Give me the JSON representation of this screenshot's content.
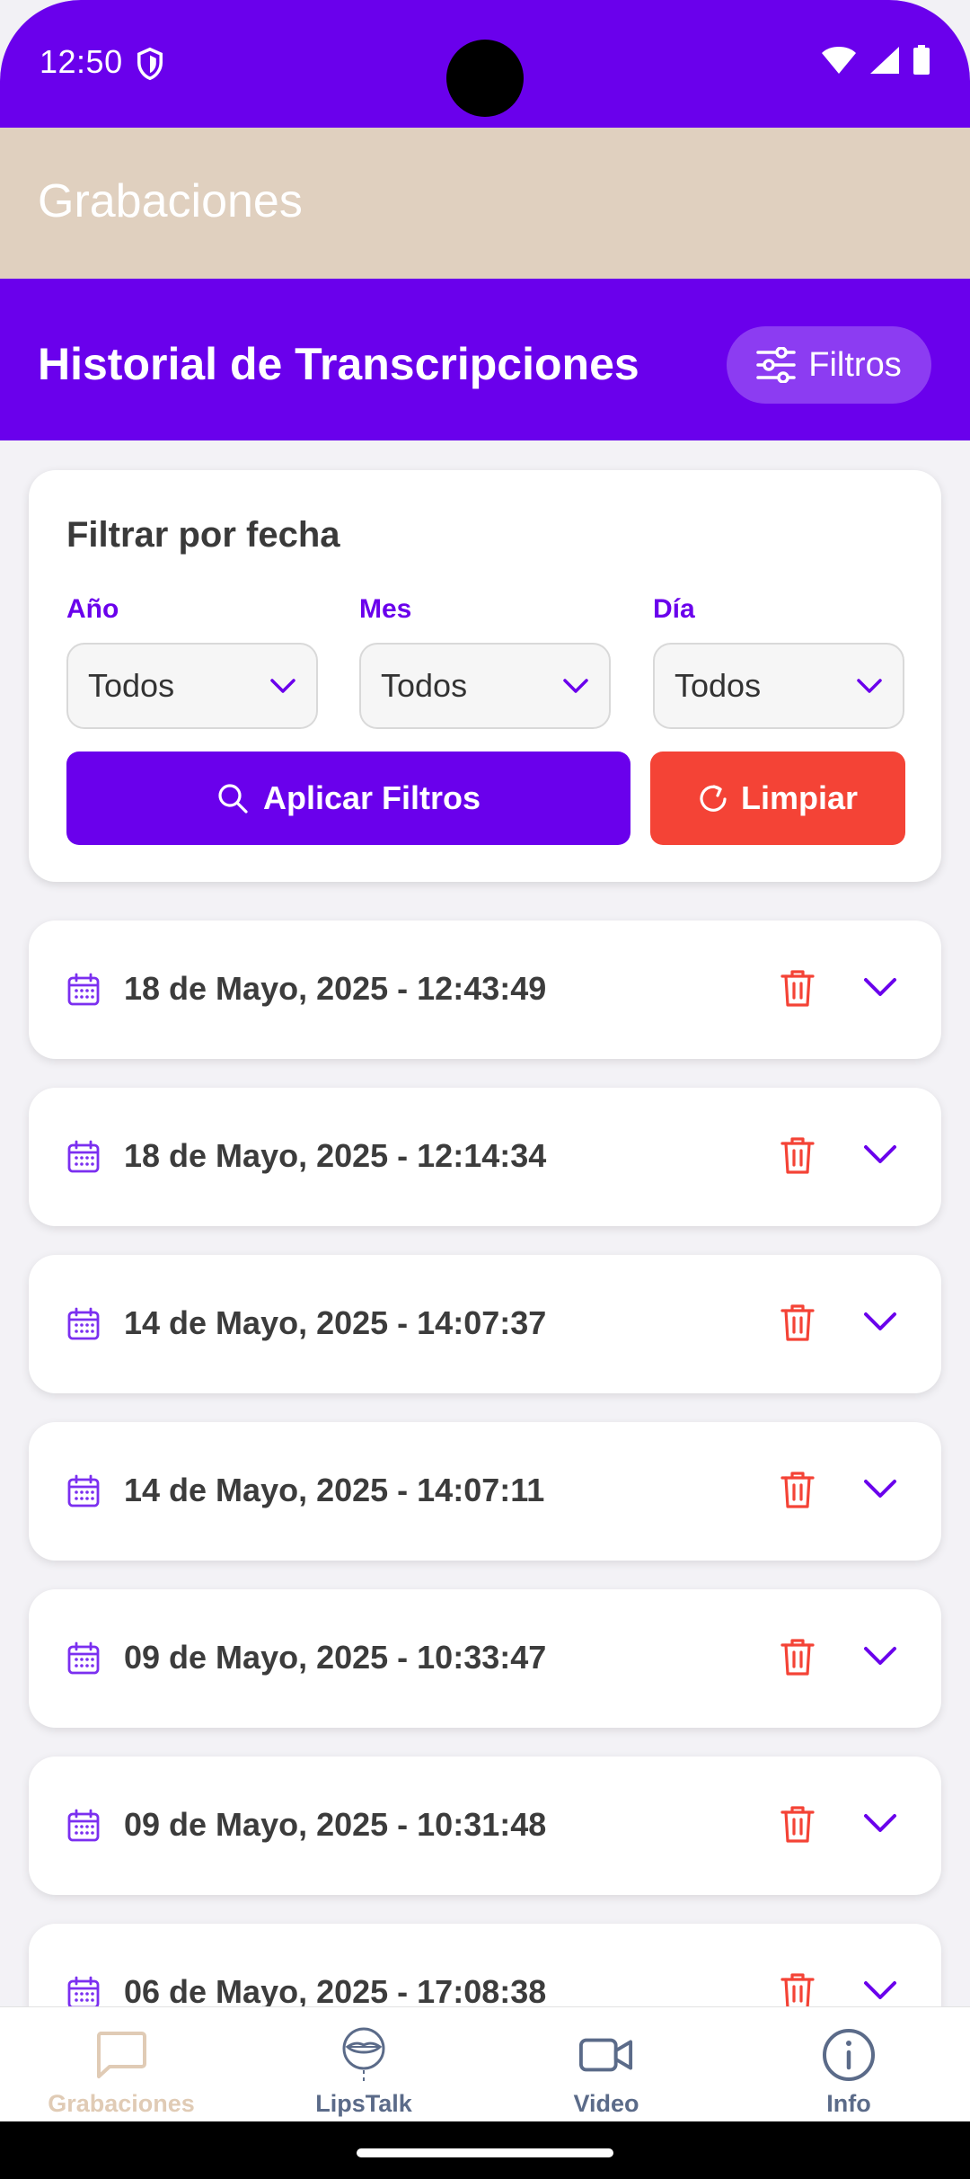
{
  "status_bar": {
    "time": "12:50"
  },
  "app_bar": {
    "title": "Grabaciones"
  },
  "header": {
    "title": "Historial de Transcripciones",
    "filters_button": "Filtros"
  },
  "filter_card": {
    "title": "Filtrar por fecha",
    "fields": [
      {
        "label": "Año",
        "value": "Todos"
      },
      {
        "label": "Mes",
        "value": "Todos"
      },
      {
        "label": "Día",
        "value": "Todos"
      }
    ],
    "apply_label": "Aplicar Filtros",
    "clear_label": "Limpiar"
  },
  "recordings": [
    {
      "date": "18 de Mayo, 2025 - 12:43:49"
    },
    {
      "date": "18 de Mayo, 2025 - 12:14:34"
    },
    {
      "date": "14 de Mayo, 2025 - 14:07:37"
    },
    {
      "date": "14 de Mayo, 2025 - 14:07:11"
    },
    {
      "date": "09 de Mayo, 2025 - 10:33:47"
    },
    {
      "date": "09 de Mayo, 2025 - 10:31:48"
    },
    {
      "date": "06 de Mayo, 2025 - 17:08:38"
    }
  ],
  "bottom_nav": [
    {
      "label": "Grabaciones",
      "icon": "chat-bubble-icon",
      "active": true
    },
    {
      "label": "LipsTalk",
      "icon": "lipstalk-logo-icon",
      "active": false
    },
    {
      "label": "Video",
      "icon": "video-camera-icon",
      "active": false
    },
    {
      "label": "Info",
      "icon": "info-icon",
      "active": false
    }
  ],
  "colors": {
    "primary": "#6a00ec",
    "danger": "#f44336",
    "app_bar": "#e0d0bf",
    "nav_inactive": "#5b6b89",
    "nav_active": "#e0cbb5"
  }
}
